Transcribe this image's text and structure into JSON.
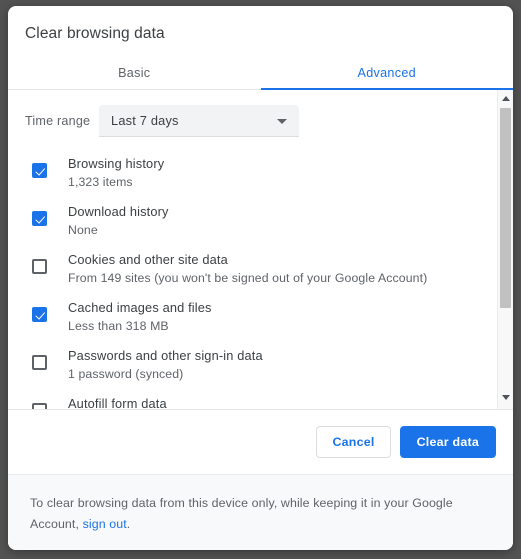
{
  "dialog": {
    "title": "Clear browsing data"
  },
  "tabs": [
    {
      "label": "Basic",
      "active": false
    },
    {
      "label": "Advanced",
      "active": true
    }
  ],
  "time_range": {
    "label": "Time range",
    "selected": "Last 7 days",
    "arrow_icon": "chevron-down-icon"
  },
  "data_types": [
    {
      "label": "Browsing history",
      "detail": "1,323 items",
      "checked": true
    },
    {
      "label": "Download history",
      "detail": "None",
      "checked": true
    },
    {
      "label": "Cookies and other site data",
      "detail": "From 149 sites (you won't be signed out of your Google Account)",
      "checked": false
    },
    {
      "label": "Cached images and files",
      "detail": "Less than 318 MB",
      "checked": true
    },
    {
      "label": "Passwords and other sign-in data",
      "detail": "1 password (synced)",
      "checked": false
    },
    {
      "label": "Autofill form data",
      "detail": "",
      "checked": false
    }
  ],
  "scrollbar": {
    "up_arrow_icon": "scroll-up-arrow-icon",
    "down_arrow_icon": "scroll-down-arrow-icon"
  },
  "actions": {
    "cancel_label": "Cancel",
    "confirm_label": "Clear data"
  },
  "footer": {
    "text_before": "To clear browsing data from this device only, while keeping it in your Google Account, ",
    "link_label": "sign out",
    "text_after": "."
  },
  "colors": {
    "accent": "#1a73e8",
    "text_primary": "#3c4043",
    "text_secondary": "#5f6368",
    "footer_bg": "#f8f9fa",
    "select_bg": "#f1f3f4",
    "scrollbar_thumb": "#c1c1c1"
  }
}
